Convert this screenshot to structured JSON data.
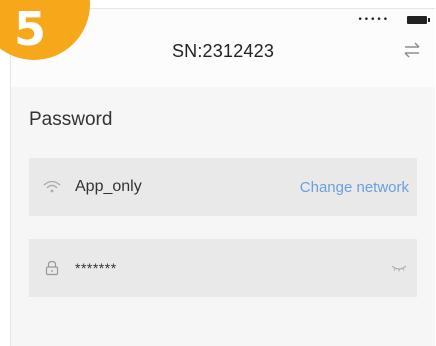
{
  "step_badge": {
    "number": "5",
    "color": "#f6a81a"
  },
  "status_bar": {
    "signal": "•••••",
    "battery_icon": "battery-icon"
  },
  "header": {
    "title": "SN:2312423",
    "swap_icon": "swap-arrows-icon"
  },
  "section": {
    "label": "Password"
  },
  "wifi_field": {
    "icon": "wifi-icon",
    "network_name": "App_only",
    "change_link": "Change network",
    "link_color": "#6a9fe0"
  },
  "password_field": {
    "icon": "lock-icon",
    "value": "*******",
    "toggle_icon": "eye-closed-icon"
  }
}
